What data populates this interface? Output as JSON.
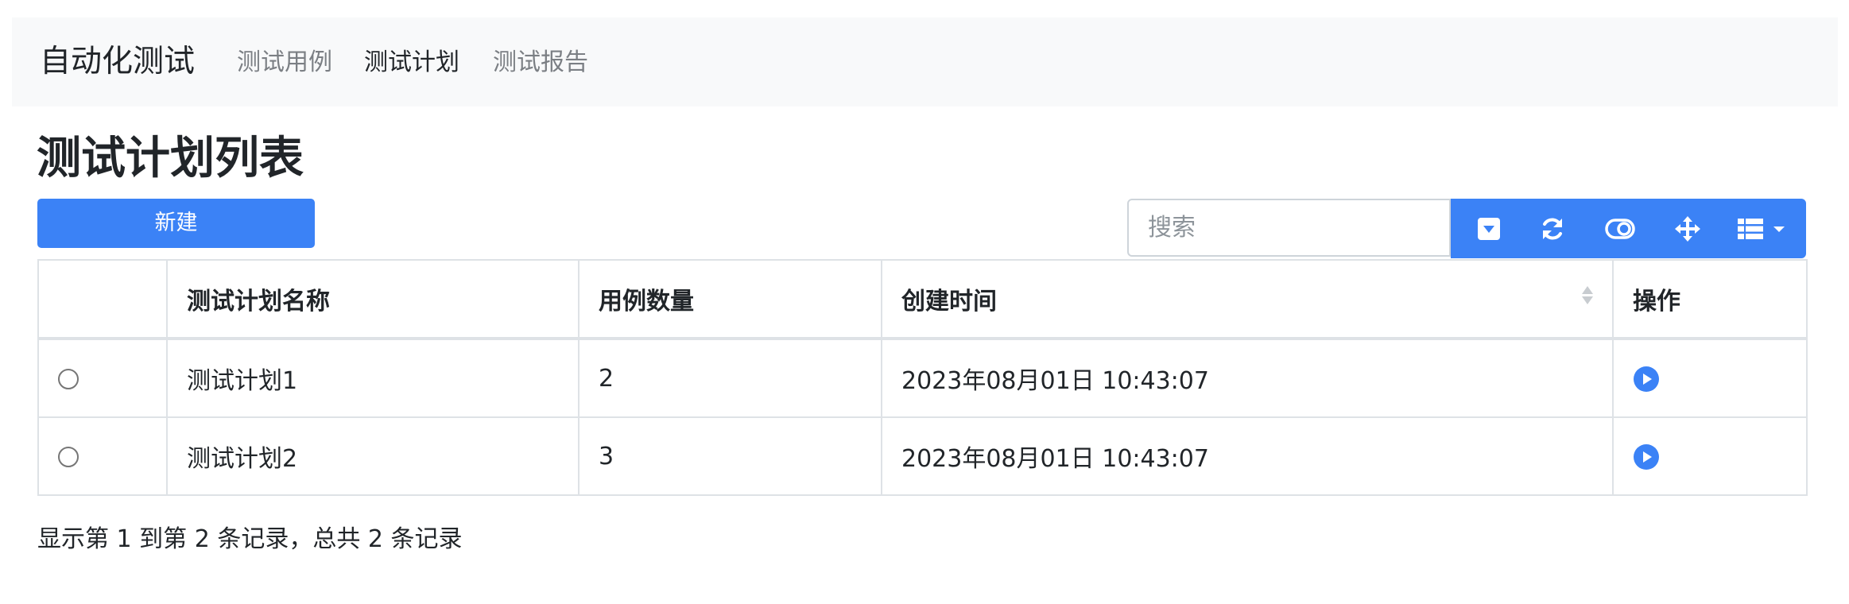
{
  "navbar": {
    "brand": "自动化测试",
    "links": [
      {
        "label": "测试用例",
        "active": false
      },
      {
        "label": "测试计划",
        "active": true
      },
      {
        "label": "测试报告",
        "active": false
      }
    ]
  },
  "page": {
    "title": "测试计划列表",
    "new_button": "新建"
  },
  "search": {
    "placeholder": "搜索",
    "value": ""
  },
  "toolbar": {
    "buttons": [
      {
        "icon": "caret-square-down-icon"
      },
      {
        "icon": "refresh-icon"
      },
      {
        "icon": "toggle-icon"
      },
      {
        "icon": "fullscreen-move-icon"
      },
      {
        "icon": "columns-list-icon"
      }
    ],
    "color": "#3b82f6"
  },
  "table": {
    "columns": [
      "",
      "测试计划名称",
      "用例数量",
      "创建时间",
      "操作"
    ],
    "rows": [
      {
        "name": "测试计划1",
        "count": "2",
        "created": "2023年08月01日 10:43:07",
        "action_icon": "play-circle-icon"
      },
      {
        "name": "测试计划2",
        "count": "3",
        "created": "2023年08月01日 10:43:07",
        "action_icon": "play-circle-icon"
      }
    ]
  },
  "footer": {
    "info": "显示第 1 到第 2 条记录，总共 2 条记录"
  }
}
